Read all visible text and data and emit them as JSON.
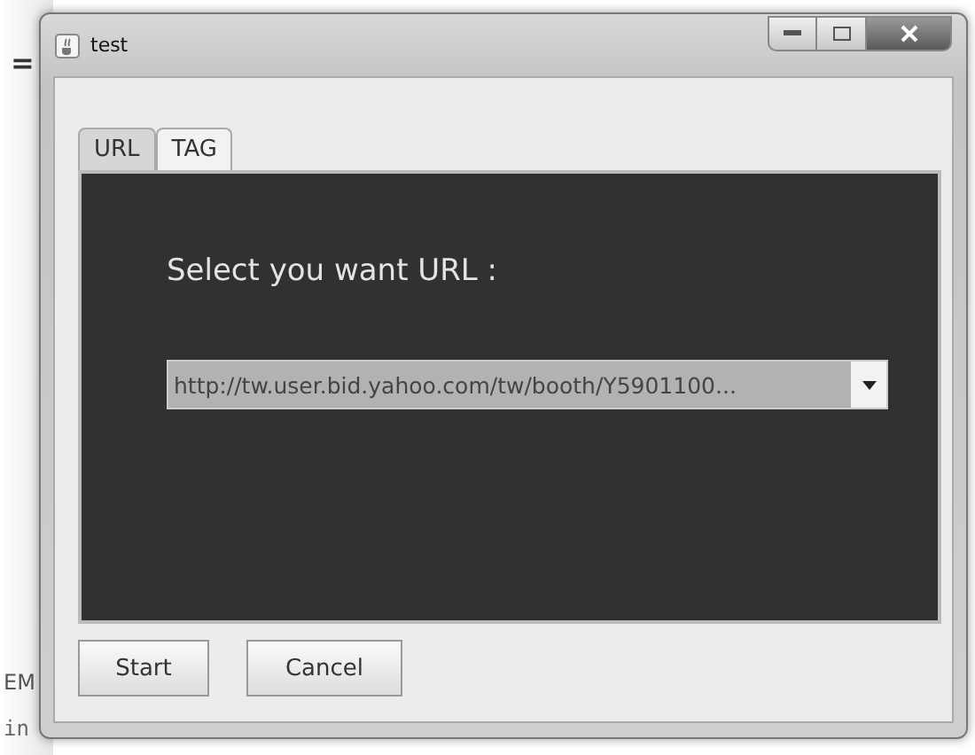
{
  "background_text": [
    "=",
    "EM",
    "in"
  ],
  "window": {
    "title": "test"
  },
  "tabs": [
    {
      "label": "URL",
      "selected": true
    },
    {
      "label": "TAG",
      "selected": false
    }
  ],
  "panel": {
    "prompt": "Select you want URL :",
    "combo": {
      "value": "http://tw.user.bid.yahoo.com/tw/booth/Y5901100..."
    }
  },
  "buttons": [
    "Start",
    "Cancel"
  ]
}
